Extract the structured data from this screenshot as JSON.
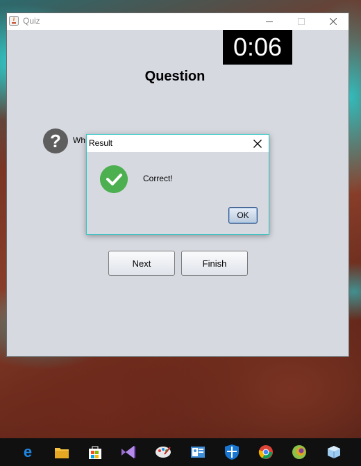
{
  "window": {
    "title": "Quiz",
    "timer": "0:06",
    "heading": "Question",
    "question_icon": "question-icon",
    "question_text": "Wh",
    "buttons": {
      "next": "Next",
      "finish": "Finish"
    }
  },
  "dialog": {
    "title": "Result",
    "message": "Correct!",
    "ok_label": "OK",
    "icon": "check-icon"
  },
  "taskbar": {
    "icons": [
      "edge-icon",
      "file-explorer-icon",
      "store-icon",
      "visual-studio-icon",
      "paint-icon",
      "contacts-icon",
      "defender-icon",
      "chrome-icon",
      "eclipse-icon",
      "virtualbox-icon"
    ]
  },
  "colors": {
    "check": "#4caf50",
    "dialog_border": "#35c6c6",
    "timer_bg": "#000000"
  }
}
